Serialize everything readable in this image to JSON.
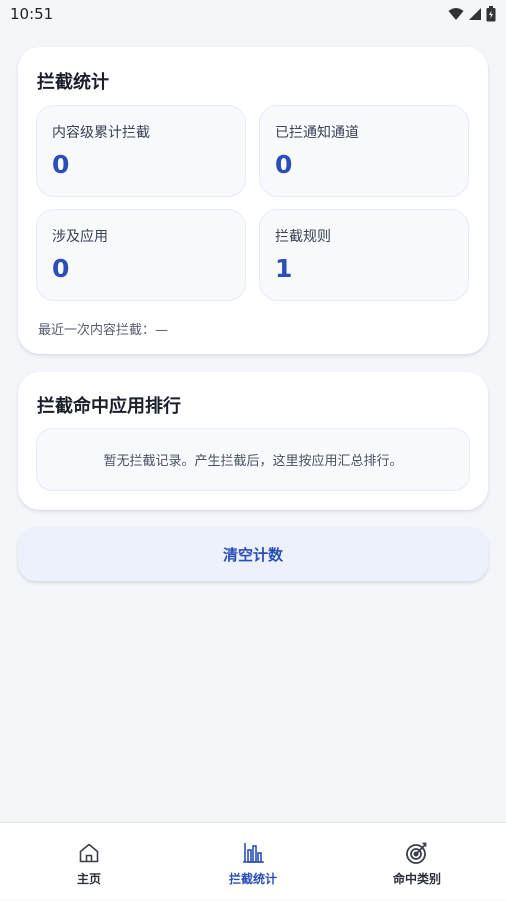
{
  "status_bar": {
    "time": "10:51",
    "icons": [
      "wifi-icon",
      "signal-icon",
      "battery-icon"
    ]
  },
  "stats_card": {
    "title": "拦截统计",
    "tiles": [
      {
        "label": "内容级累计拦截",
        "value": "0"
      },
      {
        "label": "已拦通知通道",
        "value": "0"
      },
      {
        "label": "涉及应用",
        "value": "0"
      },
      {
        "label": "拦截规则",
        "value": "1"
      }
    ],
    "last_intercept": "最近一次内容拦截：—"
  },
  "rank_card": {
    "title": "拦截命中应用排行",
    "empty_text": "暂无拦截记录。产生拦截后，这里按应用汇总排行。"
  },
  "actions": {
    "clear_label": "清空计数"
  },
  "bottom_nav": {
    "items": [
      {
        "label": "主页",
        "icon": "home-icon",
        "active": false
      },
      {
        "label": "拦截统计",
        "icon": "bar-chart-icon",
        "active": true
      },
      {
        "label": "命中类别",
        "icon": "target-icon",
        "active": false
      }
    ]
  },
  "colors": {
    "accent": "#2a4fb8",
    "background": "#f4f6fa",
    "card": "#ffffff",
    "tile": "#f7f9fd"
  }
}
